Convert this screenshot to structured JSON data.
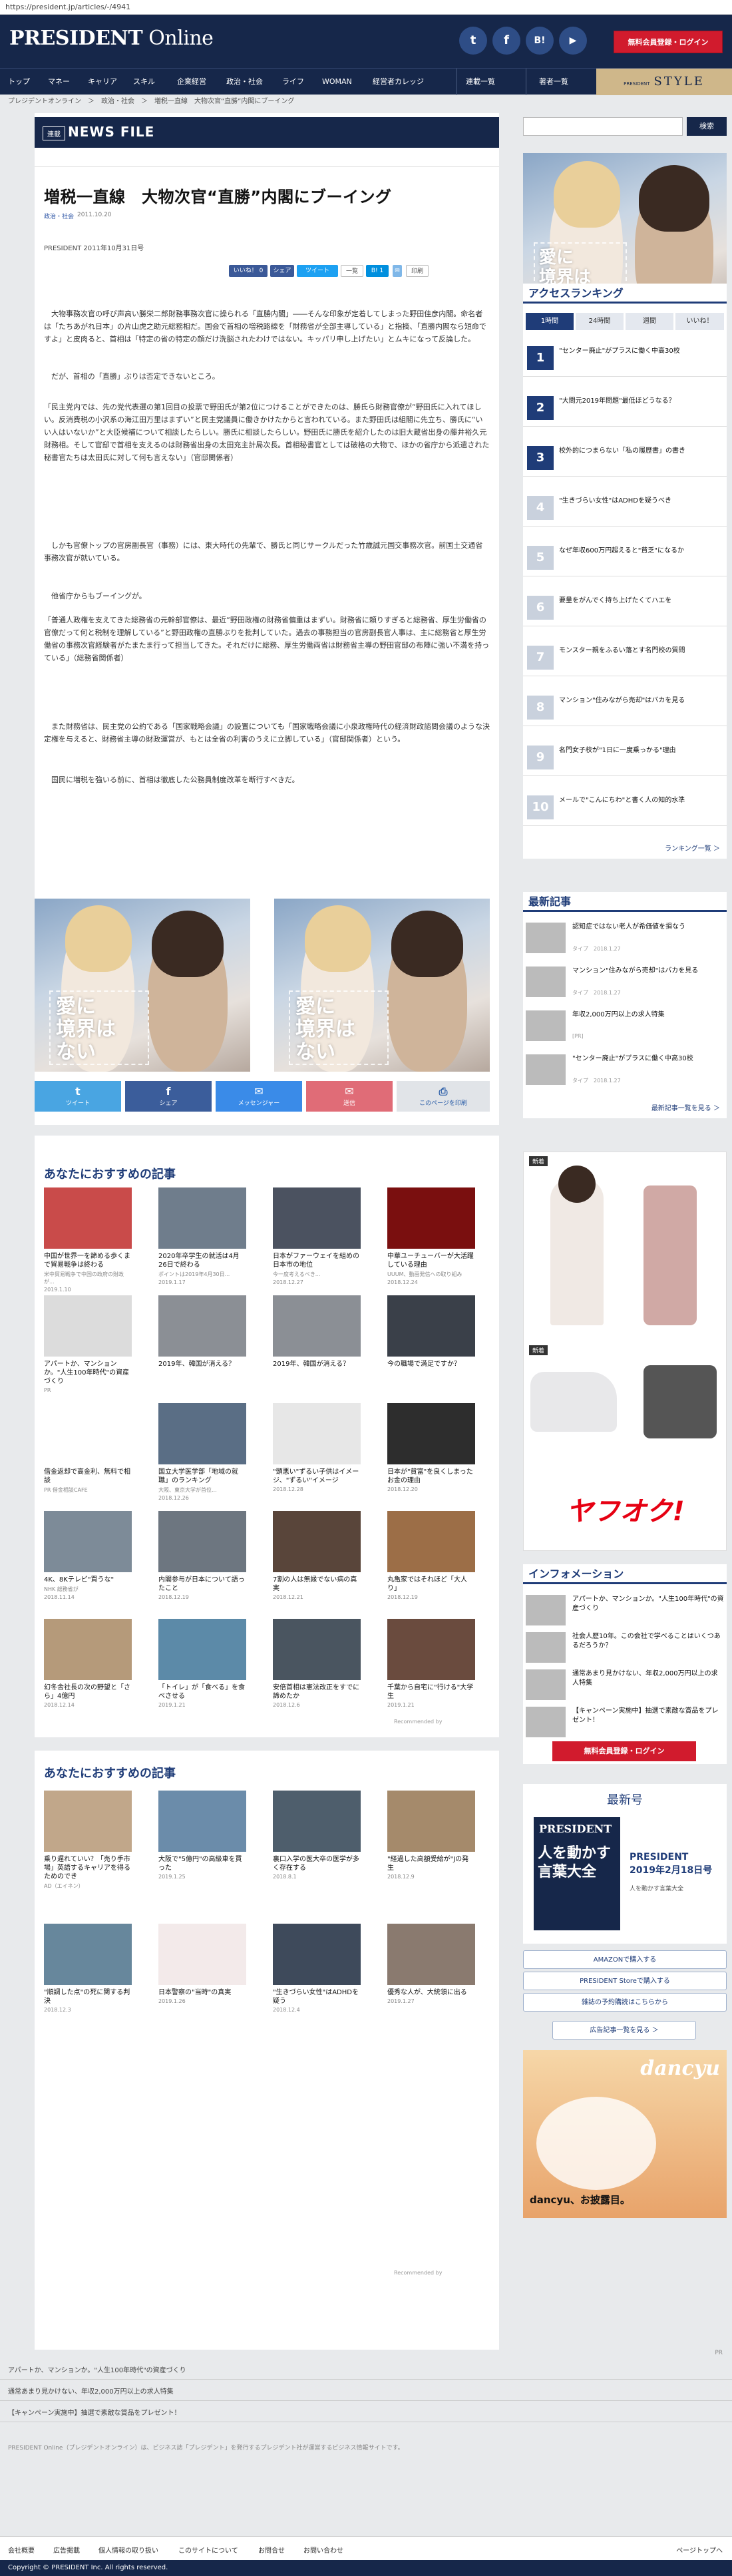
{
  "url": "https://president.jp/articles/-/4941",
  "header": {
    "logo_main": "PRESIDENT",
    "logo_sub": " Online",
    "login": "無料会員登録・ログイン",
    "social": [
      "t",
      "f",
      "B!",
      "▶"
    ]
  },
  "nav": {
    "items": [
      "トップ",
      "マネー",
      "キャリア",
      "スキル",
      "企業経営",
      "政治・社会",
      "ライフ",
      "WOMAN",
      "経営者カレッジ",
      "連載一覧",
      "著者一覧"
    ],
    "style_small": "PRESIDENT",
    "style": "STYLE"
  },
  "breadcrumb": "プレジデントオンライン　＞　政治・社会　＞　増税一直線　大物次官“直勝”内閣にブーイング",
  "article": {
    "label": "連載",
    "section": "NEWS FILE",
    "title": "増税一直線　大物次官“直勝”内閣にブーイング",
    "category": "政治・社会",
    "date": "2011.10.20",
    "issue": "PRESIDENT 2011年10月31日号",
    "share": [
      "いいね！ 0",
      "シェア",
      "ツイート",
      "B! 1",
      "印刷"
    ],
    "paragraphs": [
      "　大物事務次官の呼び声高い勝栄二郎財務事務次官に操られる「直勝内閣」――そんな印象が定着してしまった野田佳彦内閣。命名者は「たちあがれ日本」の片山虎之助元総務相だ。国会で首相の増税路線を「財務省が全部主導している」と指摘、「直勝内閣なら短命ですよ」と皮肉ると、首相は「特定の省の特定の顔だけ洗脳されたわけではない。キッパリ申し上げたい」とムキになって反論した。",
      "　だが、首相の「直勝」ぶりは否定できないところ。",
      "「民主党内では、先の党代表選の第1回目の投票で野田氏が第2位につけることができたのは、勝氏ら財務官僚が“野田氏に入れてほしい。反消費税の小沢系の海江田万里はまずい”と民主党議員に働きかけたからと言われている。また野田氏は組閣に先立ち、勝氏に“いい人はいないか”と大臣候補について相談したらしい。勝氏に相談したらしい。野田氏に勝氏を紹介したのは旧大蔵省出身の藤井裕久元財務相。そして官邸で首相を支えるのは財務省出身の太田充主計局次長。首相秘書官としては破格の大物で、ほかの省庁から派遣された秘書官たちは太田氏に対して何も言えない」（官邸関係者）",
      "　しかも官僚トップの官房副長官（事務）には、東大時代の先輩で、勝氏と同じサークルだった竹歳誠元国交事務次官。前国土交通省事務次官が就いている。",
      "　他省庁からもブーイングが。",
      "「普通人政権を支えてきた総務省の元幹部官僚は、最近“野田政権の財務省偏重はまずい。財務省に頼りすぎると総務省、厚生労働省の官僚だって何と税制を理解している”と野田政権の直勝ぶりを批判していた。過去の事務担当の官房副長官人事は、主に総務省と厚生労働省の事務次官経験者がたまたま行って担当してきた。それだけに総務、厚生労働両省は財務省主導の野田官邸の布陣に強い不満を持っている」（総務省関係者）",
      "　また財務省は、民主党の公約である「国家戦略会議」の設置についても「国家戦略会議に小泉政権時代の経済財政諮問会議のような決定権を与えると、財務省主導の財政運営が、もとは全省の利害のうえに立脚している」（官邸関係者）という。",
      "　国民に増税を強いる前に、首相は徹底した公務員制度改革を断行すべきだ。"
    ],
    "ad_text": "愛に\n境界は\nない",
    "share_bottom": [
      {
        "label": "ツイート",
        "icon": "t",
        "color": "#49a5e2"
      },
      {
        "label": "シェア",
        "icon": "f",
        "color": "#3b5d9b"
      },
      {
        "label": "メッセンジャー",
        "icon": "✉",
        "color": "#3a8be8"
      },
      {
        "label": "送信",
        "icon": "✉",
        "color": "#e06c77"
      },
      {
        "label": "このページを印刷",
        "icon": "⎙",
        "color": "#e1e4e8"
      }
    ]
  },
  "reco1": {
    "title": "あなたにおすすめの記事",
    "items": [
      {
        "cap": "中国が世界一を諦める歩くまで貿易戦争は終わる",
        "sub": "米中貿易戦争で中国の政府の財政が...",
        "dt": "2019.1.10",
        "color": "#c94b4a"
      },
      {
        "cap": "2020年卒学生の就活は4月26日で終わる",
        "sub": "ポイントは2019年4月30日...",
        "dt": "2019.1.17",
        "color": "#6f7d8c"
      },
      {
        "cap": "日本がファーウェイを組めの日本市の地位",
        "sub": "今一度考えるべき...",
        "dt": "2018.12.27",
        "color": "#4b5260"
      },
      {
        "cap": "中華ユーチューバーが大活躍している理由",
        "sub": "UUUM、動画発信への取り組み",
        "dt": "2018.12.24",
        "color": "#7a0f0f"
      },
      {
        "cap": "アパートか、マンションか。\"人生100年時代\"の資産づくり",
        "sub": "PR",
        "dt": "",
        "color": "#dcdcdc"
      },
      {
        "cap": "2019年、韓国が消える？",
        "sub": "",
        "dt": "",
        "color": "#8b8f95"
      },
      {
        "cap": "2019年、韓国が消える？",
        "sub": "",
        "dt": "",
        "color": "#8b8f95"
      },
      {
        "cap": "今の職場で満足ですか？",
        "sub": "",
        "dt": "",
        "color": "#3a4049"
      },
      {
        "cap": "借金返却で高金利、無料で相談",
        "sub": "PR 借金相談CAFE",
        "dt": "",
        "color": "#ffffff"
      },
      {
        "cap": "国立大学医学部「地域の就職」のランキング",
        "sub": "大阪、東京大学が首位...",
        "dt": "2018.12.26",
        "color": "#5a6e85"
      },
      {
        "cap": "\"頭悪い\"ずるい子供はイメージ、\"ずるい\"イメージ",
        "sub": "",
        "dt": "2018.12.28",
        "color": "#e7e7e7"
      },
      {
        "cap": "日本が\"貧富\"を良くしまったお金の理由",
        "sub": "",
        "dt": "2018.12.20",
        "color": "#2d2d2d"
      },
      {
        "cap": "4K、8Kテレビ\"買うな\"",
        "sub": "NHK 総務省が",
        "dt": "2018.11.14",
        "color": "#7d8b98"
      },
      {
        "cap": "内閣参与が日本について語ったこと",
        "sub": "",
        "dt": "2018.12.19",
        "color": "#6d7680"
      },
      {
        "cap": "7割の人は無縁でない病の真実",
        "sub": "",
        "dt": "2018.12.21",
        "color": "#59453a"
      },
      {
        "cap": "丸亀家ではそれほど「大人り」",
        "sub": "",
        "dt": "2018.12.19",
        "color": "#9c6e47"
      },
      {
        "cap": "幻冬舎社長の次の野望と「さら」4億円",
        "sub": "",
        "dt": "2018.12.14",
        "color": "#b59a7a"
      },
      {
        "cap": "「トイレ」が「食べる」を食べさせる",
        "sub": "",
        "dt": "2019.1.21",
        "color": "#5c8aa8"
      },
      {
        "cap": "安倍首相は憲法改正をすでに諦めたか",
        "sub": "",
        "dt": "2018.12.6",
        "color": "#4a5560"
      },
      {
        "cap": "千葉から自宅に\"行ける\"大学生",
        "sub": "",
        "dt": "2019.1.21",
        "color": "#6a4b3e"
      }
    ],
    "recommended_by": "Recommended by"
  },
  "reco2": {
    "title": "あなたにおすすめの記事",
    "items": [
      {
        "cap": "乗り遅れていい？「売り手市場」英語するキャリアを得るためのでき",
        "sub": "AD（エイネン）",
        "dt": "",
        "color": "#c1a78a"
      },
      {
        "cap": "大阪で\"5億円\"の高級車を買った",
        "sub": "",
        "dt": "2019.1.25",
        "color": "#6b8caa"
      },
      {
        "cap": "裏口入学の医大卒の医学が多く存在する",
        "sub": "",
        "dt": "2018.8.1",
        "color": "#4e5e6c"
      },
      {
        "cap": "\"経過した高額受給が\"Jの発生",
        "sub": "",
        "dt": "2018.12.9",
        "color": "#a58a6b"
      },
      {
        "cap": "\"順調した点\"の死に関する判決",
        "sub": "",
        "dt": "2018.12.3",
        "color": "#67879c"
      },
      {
        "cap": "日本警察の\"当時\"の真実",
        "sub": "",
        "dt": "2019.1.26",
        "color": "#f3eaea"
      },
      {
        "cap": "\"生きづらい女性\"はADHDを疑う",
        "sub": "",
        "dt": "2018.12.4",
        "color": "#3e4a5b"
      },
      {
        "cap": "優秀な人が、大統領に出る",
        "sub": "",
        "dt": "2019.1.27",
        "color": "#8a7a6f"
      }
    ],
    "recommended_by": "Recommended by"
  },
  "footer": {
    "pr": "PR",
    "links": [
      "アパートか、マンションか。\"人生100年時代\"の資産づくり",
      "通常あまり見かけない、年収2,000万円以上の求人特集",
      "【キャンペーン実施中】抽選で素敵な賞品をプレゼント！"
    ],
    "disclaimer": "PRESIDENT Online（プレジデントオンライン）は、ビジネス誌「プレジデント」を発行するプレジデント社が運営するビジネス情報サイトです。",
    "bottom_nav": [
      "会社概要",
      "広告掲載",
      "個人情報の取り扱い",
      "このサイトについて",
      "お問合せ",
      "お問い合わせ"
    ],
    "pagetop": "ページトップへ",
    "copyright": "Copyright © PRESIDENT Inc. All rights reserved."
  },
  "side": {
    "search": "検索",
    "ad_text": "愛に\n境界は\nない",
    "ranking_title": "アクセスランキング",
    "tabs": [
      "1時間",
      "24時間",
      "週間",
      "いいね！"
    ],
    "ranking": [
      "\"センター廃止\"がプラスに働く中高30校",
      "\"大問元2019年問題\"最低ほどうなる？",
      "校外的につまらない「私の履歴書」の書き",
      "\"生きづらい女性\"はADHDを疑うべき",
      "なぜ年収600万円超えると\"貧乏\"になるか",
      "要量をがんでく持ち上げたくてハエを",
      "モンスター親をふるい落とす名門校の質問",
      "マンション\"住みながら売却\"はバカを見る",
      "名門女子校が\"1日に一度乗っかる\"理由",
      "メールで\"こんにちわ\"と書く人の知的水準"
    ],
    "ranking_more": "ランキング一覧 ＞",
    "news_title": "最新記事",
    "news": [
      {
        "t": "認知症ではない老人が希価値を損なう",
        "d": "タイプ　2018.1.27"
      },
      {
        "t": "マンション\"住みながら売却\"はバカを見る",
        "d": "タイプ　2018.1.27"
      },
      {
        "t": "年収2,000万円以上の求人特集",
        "d": "[PR]"
      },
      {
        "t": "\"センター廃止\"がプラスに働く中高30校",
        "d": "タイプ　2018.1.27"
      }
    ],
    "news_more": "最新記事一覧を見る ＞",
    "ad2_label": "新着",
    "ad2_brand": "ヤフオク!",
    "info_title": "インフォメーション",
    "info": [
      "アパートか、マンションか。\"人生100年時代\"の資産づくり",
      "社会人歴10年。この会社で学べることはいくつあるだろうか？",
      "通常あまり見かけない、年収2,000万円以上の求人特集",
      "【キャンペーン実施中】抽選で素敵な賞品をプレゼント！"
    ],
    "login": "無料会員登録・ログイン",
    "latest_title": "最新号",
    "mag_title": "PRESIDENT\n2019年2月18日号",
    "mag_sub": "人を動かす言葉大全",
    "mag_cover": "人を動かす言葉大全",
    "buttons": [
      "AMAZONで購入する",
      "PRESIDENT Storeで購入する",
      "雑誌の予約購読はこちらから"
    ],
    "ad_list": "広告記事一覧を見る ＞",
    "dancyu": "dancyu、お披露目。",
    "dancyu_brand": "dancyu"
  }
}
